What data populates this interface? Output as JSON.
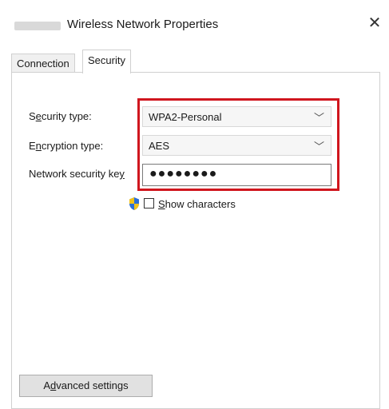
{
  "window": {
    "title": "Wireless Network Properties",
    "close_symbol": "✕"
  },
  "tabs": [
    {
      "label": "Connection",
      "selected": false
    },
    {
      "label": "Security",
      "selected": true
    }
  ],
  "security": {
    "security_type_label_pre": "S",
    "security_type_label_u": "e",
    "security_type_label_post": "curity type:",
    "security_type_value": "WPA2-Personal",
    "encryption_type_label_pre": "E",
    "encryption_type_label_u": "n",
    "encryption_type_label_post": "cryption type:",
    "encryption_type_value": "AES",
    "network_key_label_pre": "Network security ke",
    "network_key_label_u": "y",
    "network_key_value": "●●●●●●●●",
    "show_characters_u": "S",
    "show_characters_rest": "how characters",
    "show_characters_checked": false,
    "advanced_pre": "A",
    "advanced_u": "d",
    "advanced_post": "vanced settings"
  },
  "icons": {
    "dropdown_chevron": "﹀",
    "shield": "shield-icon"
  },
  "colors": {
    "highlight": "#d0161e"
  }
}
